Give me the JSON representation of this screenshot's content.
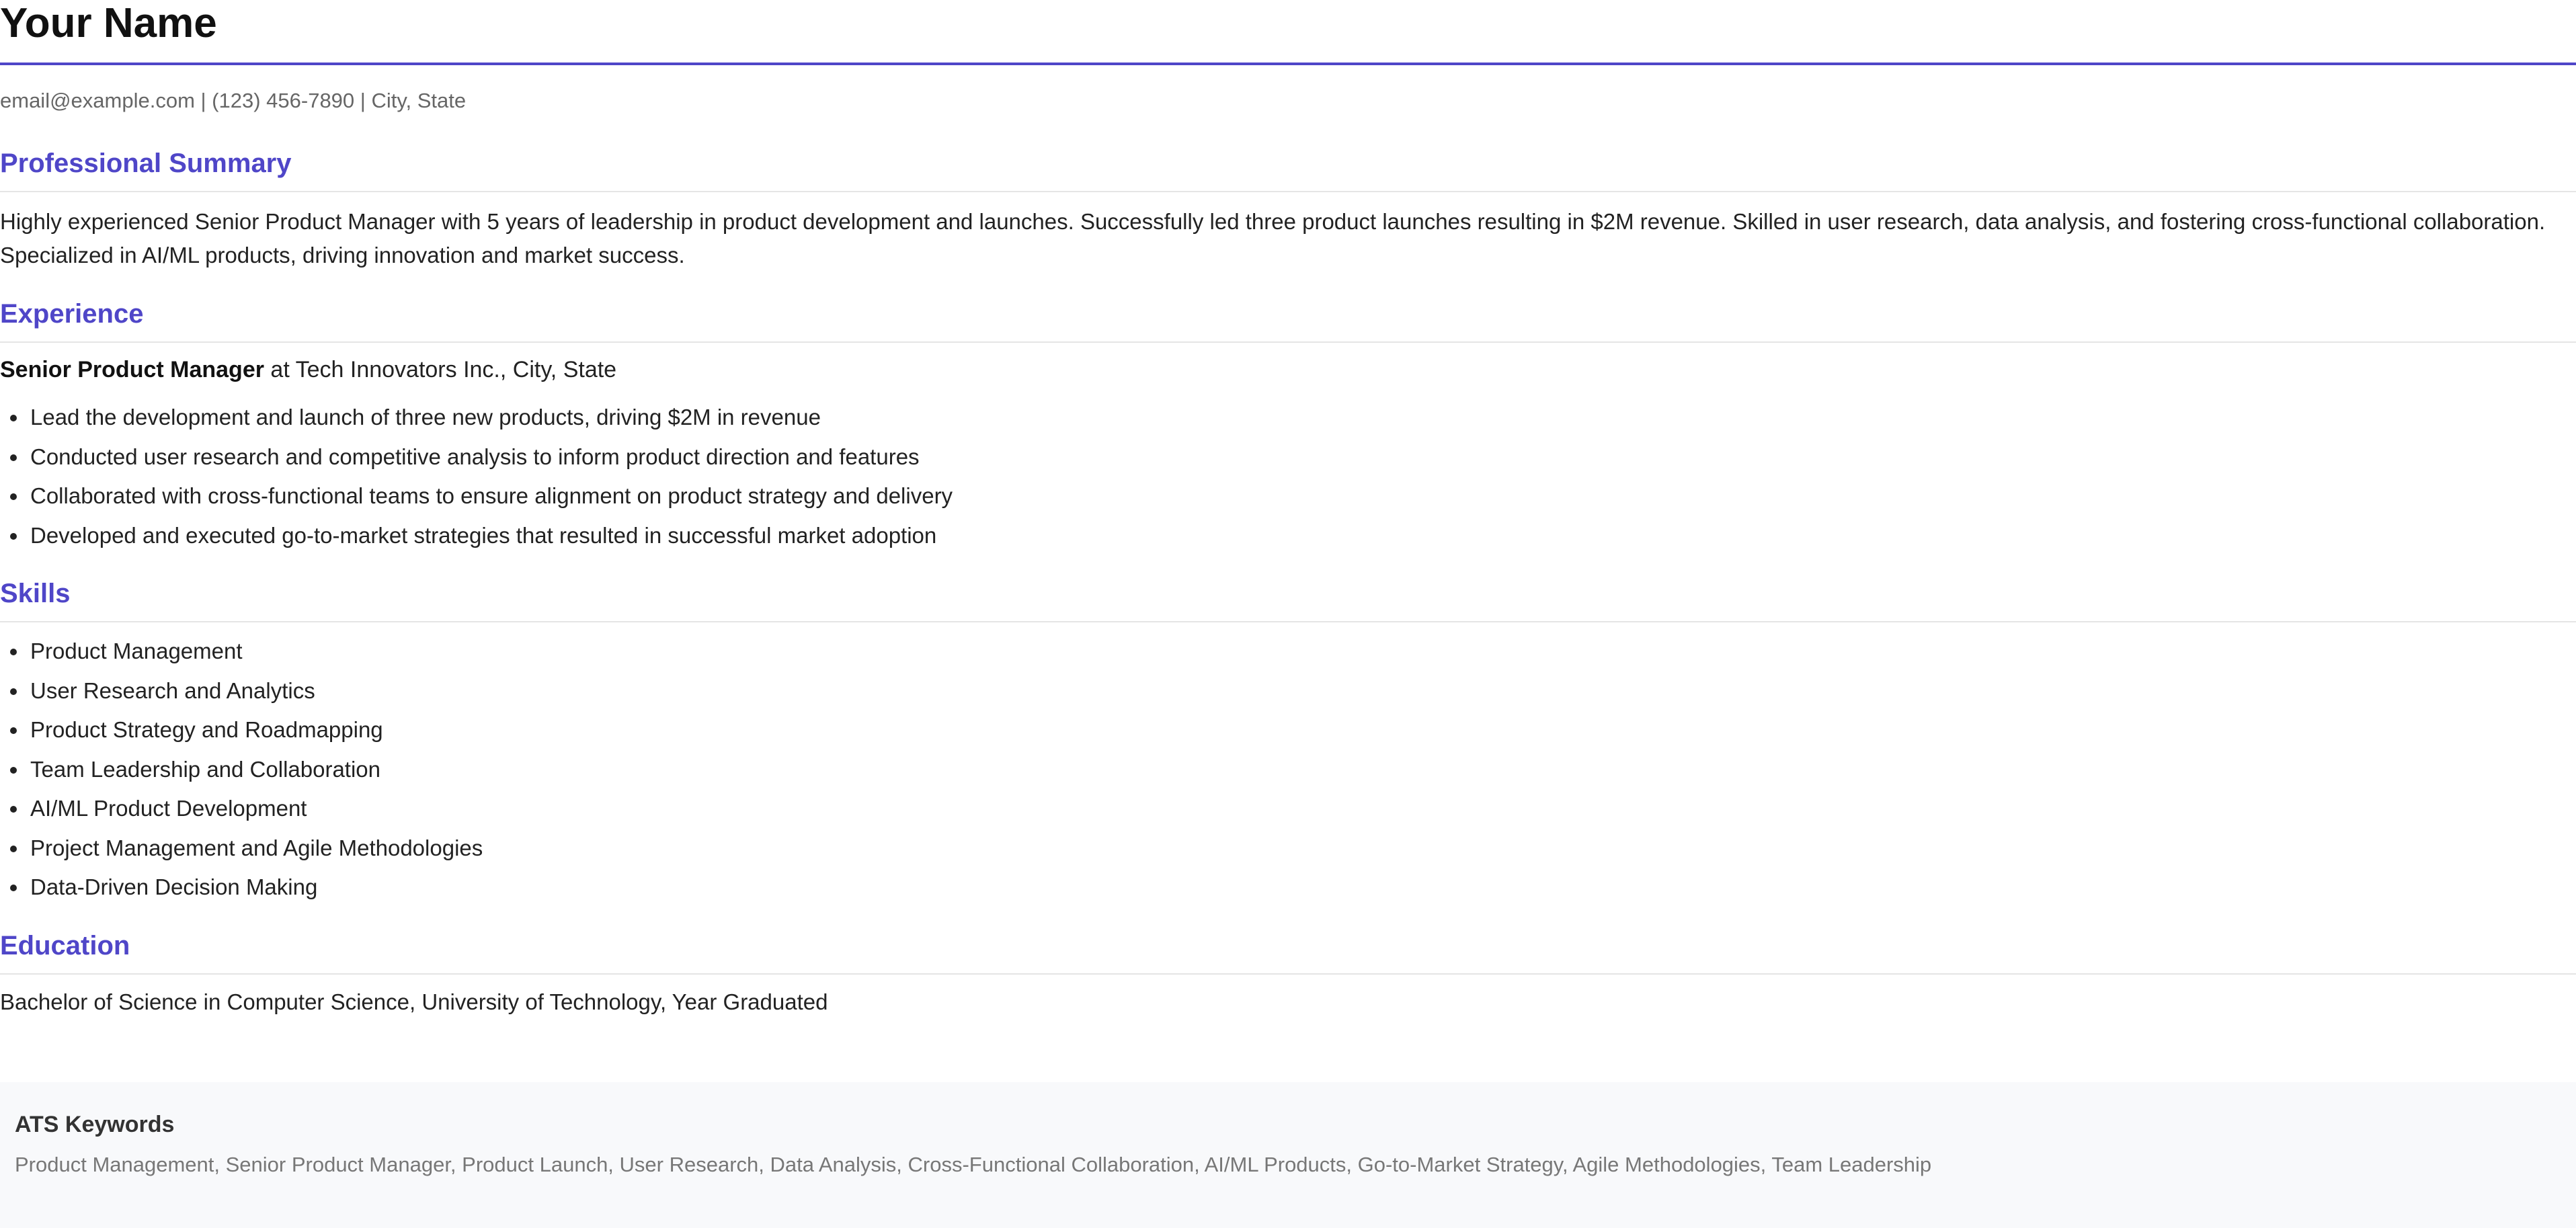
{
  "header": {
    "name": "Your Name",
    "contact": "email@example.com | (123) 456-7890 | City, State"
  },
  "summary": {
    "heading": "Professional Summary",
    "text": "Highly experienced Senior Product Manager with 5 years of leadership in product development and launches. Successfully led three product launches resulting in $2M revenue. Skilled in user research, data analysis, and fostering cross-functional collaboration. Specialized in AI/ML products, driving innovation and market success."
  },
  "experience": {
    "heading": "Experience",
    "title": "Senior Product Manager",
    "company": " at Tech Innovators Inc., City, State",
    "bullets": [
      "Lead the development and launch of three new products, driving $2M in revenue",
      "Conducted user research and competitive analysis to inform product direction and features",
      "Collaborated with cross-functional teams to ensure alignment on product strategy and delivery",
      "Developed and executed go-to-market strategies that resulted in successful market adoption"
    ]
  },
  "skills": {
    "heading": "Skills",
    "items": [
      "Product Management",
      "User Research and Analytics",
      "Product Strategy and Roadmapping",
      "Team Leadership and Collaboration",
      "AI/ML Product Development",
      "Project Management and Agile Methodologies",
      "Data-Driven Decision Making"
    ]
  },
  "education": {
    "heading": "Education",
    "text": "Bachelor of Science in Computer Science, University of Technology, Year Graduated"
  },
  "ats": {
    "title": "ATS Keywords",
    "keywords": "Product Management, Senior Product Manager, Product Launch, User Research, Data Analysis, Cross-Functional Collaboration, AI/ML Products, Go-to-Market Strategy, Agile Methodologies, Team Leadership"
  },
  "colors": {
    "accent": "#4f46c8",
    "text": "#222222",
    "muted": "#666666",
    "ats_background": "#f8f9fb"
  }
}
